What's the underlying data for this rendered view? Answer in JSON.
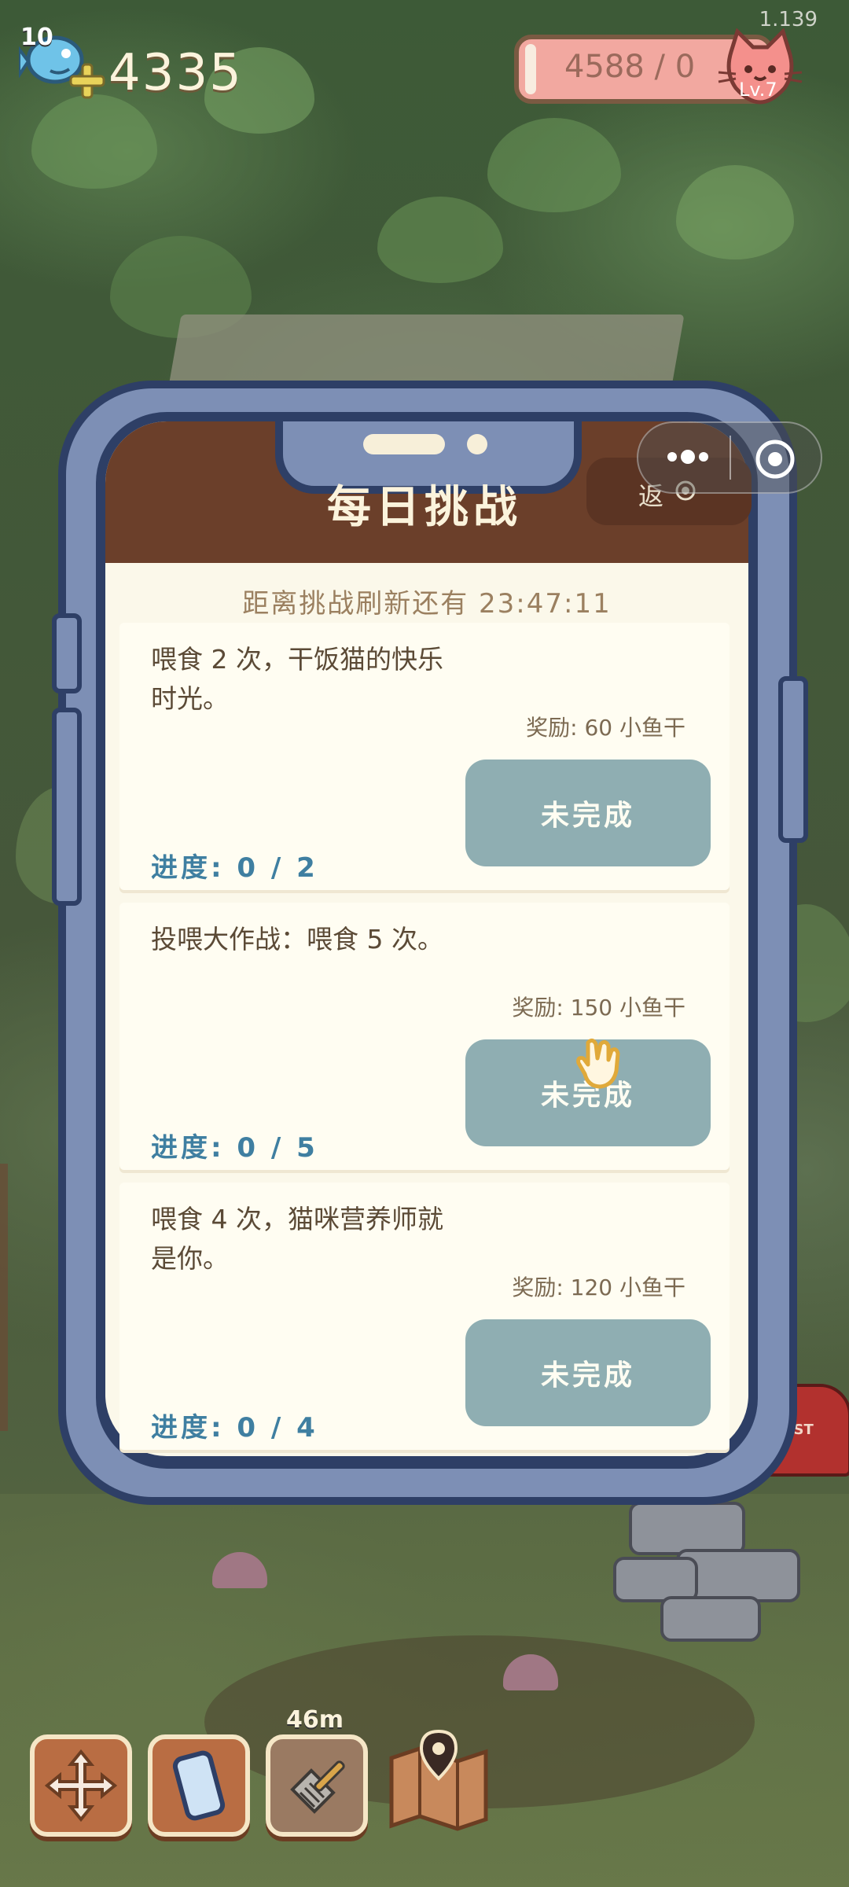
{
  "hud": {
    "level": "10",
    "coins": "4335",
    "version": "1.139",
    "exp": "4588 / 0",
    "cat_level": "Lv.7"
  },
  "modal": {
    "title": "每日挑战",
    "back_label": "返",
    "refresh_timer": "距离挑战刷新还有 23:47:11",
    "challenges": [
      {
        "description": "喂食 2 次，干饭猫的快乐时光。",
        "reward": "奖励: 60 小鱼干",
        "status": "未完成",
        "progress": "进度: 0 / 2"
      },
      {
        "description": "投喂大作战：喂食 5 次。",
        "reward": "奖励: 150 小鱼干",
        "status": "未完成",
        "progress": "进度: 0 / 5"
      },
      {
        "description": "喂食 4 次，猫咪营养师就是你。",
        "reward": "奖励: 120 小鱼干",
        "status": "未完成",
        "progress": "进度: 0 / 4"
      }
    ]
  },
  "toolbar": {
    "timer": "46m",
    "items": [
      "move-arrows-icon",
      "phone-icon",
      "litter-scoop-icon",
      "map-icon"
    ]
  },
  "colors": {
    "header_brown": "#6b3f2a",
    "phone_frame": "#7d8fb5",
    "button_teal": "#8faeb2",
    "progress_blue": "#3f7fa1"
  }
}
